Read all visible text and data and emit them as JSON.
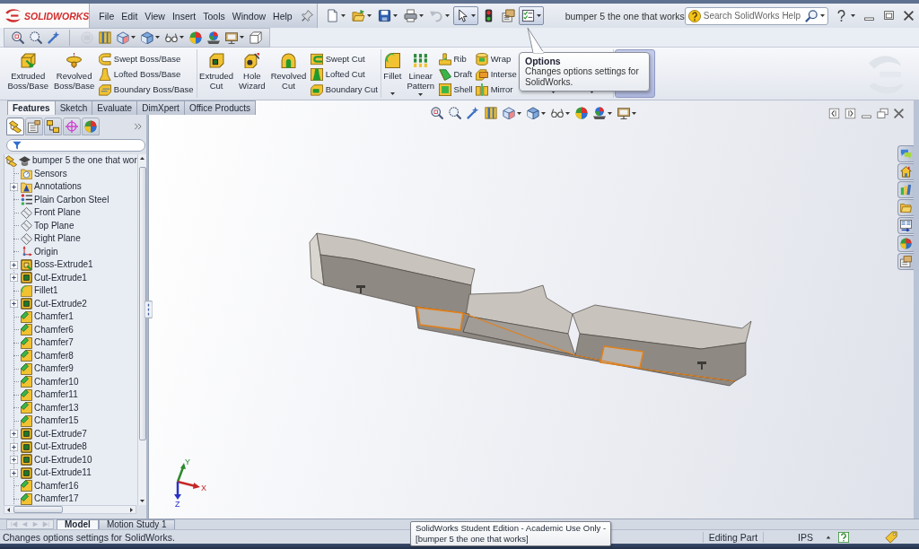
{
  "title_bar": {
    "logo": "SOLIDWORKS",
    "menu": [
      "File",
      "Edit",
      "View",
      "Insert",
      "Tools",
      "Window",
      "Help"
    ],
    "quick_access": [
      {
        "kind": "new",
        "dropdown": true,
        "selected": false,
        "disabled": false
      },
      {
        "kind": "open",
        "dropdown": true,
        "selected": false,
        "disabled": false
      },
      {
        "kind": "save",
        "dropdown": true,
        "selected": false,
        "disabled": false
      },
      {
        "kind": "print",
        "dropdown": true,
        "selected": false,
        "disabled": false
      },
      {
        "kind": "undo",
        "dropdown": true,
        "selected": false,
        "disabled": true
      },
      {
        "kind": "select",
        "dropdown": true,
        "selected": true,
        "disabled": false
      },
      {
        "kind": "rebuild",
        "dropdown": false,
        "selected": false,
        "disabled": false
      },
      {
        "kind": "properties",
        "dropdown": false,
        "selected": false,
        "disabled": false
      },
      {
        "kind": "options",
        "dropdown": true,
        "selected": true,
        "disabled": false
      }
    ],
    "document_title": "bumper 5 the one that works",
    "search": {
      "placeholder": "Search SolidWorks Help"
    }
  },
  "view_toolbar": {
    "groups": [
      {
        "tools": [
          {
            "kind": "zoom-fit",
            "dropdown": false,
            "disabled": false
          },
          {
            "kind": "zoom-area",
            "dropdown": false,
            "disabled": false
          },
          {
            "kind": "previous-view",
            "dropdown": false,
            "disabled": false
          }
        ]
      },
      {
        "tools": [
          {
            "kind": "annotation-view",
            "dropdown": false,
            "disabled": true
          },
          {
            "kind": "section-view",
            "dropdown": false,
            "disabled": false
          },
          {
            "kind": "view-orientation",
            "dropdown": true,
            "disabled": false
          },
          {
            "kind": "display-style",
            "dropdown": true,
            "disabled": false
          },
          {
            "kind": "hide-show",
            "dropdown": true,
            "disabled": false
          },
          {
            "kind": "appearance",
            "dropdown": false,
            "disabled": false
          },
          {
            "kind": "scene",
            "dropdown": false,
            "disabled": false
          },
          {
            "kind": "view-settings",
            "dropdown": true,
            "disabled": false
          },
          {
            "kind": "wireframe",
            "dropdown": false,
            "disabled": false
          }
        ]
      }
    ]
  },
  "ribbon": {
    "groups": [
      {
        "columns": [
          {
            "kind": "extrude-boss",
            "label": "Extruded Boss/Base",
            "dropdown": false
          },
          {
            "kind": "revolve-boss",
            "label": "Revolved Boss/Base",
            "dropdown": false
          },
          {
            "stack": [
              {
                "kind": "swept-boss",
                "label": "Swept Boss/Base"
              },
              {
                "kind": "lofted-boss",
                "label": "Lofted Boss/Base"
              },
              {
                "kind": "boundary-boss",
                "label": "Boundary Boss/Base"
              }
            ]
          }
        ]
      },
      {
        "columns": [
          {
            "kind": "extrude-cut",
            "label": "Extruded Cut",
            "dropdown": false
          },
          {
            "kind": "hole-wizard",
            "label": "Hole Wizard",
            "dropdown": false
          },
          {
            "kind": "revolve-cut",
            "label": "Revolved Cut",
            "dropdown": false
          },
          {
            "stack": [
              {
                "kind": "swept-cut",
                "label": "Swept Cut"
              },
              {
                "kind": "lofted-cut",
                "label": "Lofted Cut"
              },
              {
                "kind": "boundary-cut",
                "label": "Boundary Cut"
              }
            ]
          }
        ]
      },
      {
        "columns": [
          {
            "kind": "fillet",
            "label": "Fillet",
            "dropdown": true
          },
          {
            "kind": "linear-pattern",
            "label": "Linear Pattern",
            "dropdown": true
          },
          {
            "stack": [
              {
                "kind": "rib",
                "label": "Rib"
              },
              {
                "kind": "draft",
                "label": "Draft"
              },
              {
                "kind": "shell",
                "label": "Shell"
              }
            ]
          },
          {
            "stack": [
              {
                "kind": "wrap",
                "label": "Wrap"
              },
              {
                "kind": "intersect",
                "label": "Interse"
              },
              {
                "kind": "mirror",
                "label": "Mirror"
              }
            ]
          },
          {
            "kind": "covered",
            "dropdown": true,
            "highlighted": false
          },
          {
            "kind": "covered",
            "dropdown": true,
            "highlighted": false
          }
        ]
      },
      {
        "columns": [
          {
            "kind": "covered",
            "highlighted": true
          }
        ]
      }
    ]
  },
  "command_tabs": [
    {
      "label": "Features",
      "selected": true
    },
    {
      "label": "Sketch",
      "selected": false
    },
    {
      "label": "Evaluate",
      "selected": false
    },
    {
      "label": "DimXpert",
      "selected": false
    },
    {
      "label": "Office Products",
      "selected": false
    }
  ],
  "options_tooltip": {
    "title": "Options",
    "text": "Changes options settings for SolidWorks."
  },
  "feature_manager": {
    "tabs": [
      {
        "kind": "feature-tree",
        "selected": true
      },
      {
        "kind": "property",
        "selected": false
      },
      {
        "kind": "configuration",
        "selected": false
      },
      {
        "kind": "dimxpert",
        "selected": false
      },
      {
        "kind": "appearance",
        "selected": false
      }
    ],
    "tree": {
      "label": "bumper 5 the one that wor",
      "kind": "part",
      "children": [
        {
          "label": "Sensors",
          "kind": "sensors",
          "expandable": false
        },
        {
          "label": "Annotations",
          "kind": "annotations",
          "expandable": true
        },
        {
          "label": "Plain Carbon Steel",
          "kind": "material",
          "expandable": false
        },
        {
          "label": "Front Plane",
          "kind": "plane",
          "expandable": false
        },
        {
          "label": "Top Plane",
          "kind": "plane",
          "expandable": false
        },
        {
          "label": "Right Plane",
          "kind": "plane",
          "expandable": false
        },
        {
          "label": "Origin",
          "kind": "origin",
          "expandable": false
        },
        {
          "label": "Boss-Extrude1",
          "kind": "boss",
          "expandable": true
        },
        {
          "label": "Cut-Extrude1",
          "kind": "cut",
          "expandable": true
        },
        {
          "label": "Fillet1",
          "kind": "fillet",
          "expandable": false
        },
        {
          "label": "Cut-Extrude2",
          "kind": "cut",
          "expandable": true
        },
        {
          "label": "Chamfer1",
          "kind": "chamfer",
          "expandable": false
        },
        {
          "label": "Chamfer6",
          "kind": "chamfer",
          "expandable": false
        },
        {
          "label": "Chamfer7",
          "kind": "chamfer",
          "expandable": false
        },
        {
          "label": "Chamfer8",
          "kind": "chamfer",
          "expandable": false
        },
        {
          "label": "Chamfer9",
          "kind": "chamfer",
          "expandable": false
        },
        {
          "label": "Chamfer10",
          "kind": "chamfer",
          "expandable": false
        },
        {
          "label": "Chamfer11",
          "kind": "chamfer",
          "expandable": false
        },
        {
          "label": "Chamfer13",
          "kind": "chamfer",
          "expandable": false
        },
        {
          "label": "Chamfer15",
          "kind": "chamfer",
          "expandable": false
        },
        {
          "label": "Cut-Extrude7",
          "kind": "cut",
          "expandable": true
        },
        {
          "label": "Cut-Extrude8",
          "kind": "cut",
          "expandable": true
        },
        {
          "label": "Cut-Extrude10",
          "kind": "cut",
          "expandable": true
        },
        {
          "label": "Cut-Extrude11",
          "kind": "cut",
          "expandable": true
        },
        {
          "label": "Chamfer16",
          "kind": "chamfer",
          "expandable": false
        },
        {
          "label": "Chamfer17",
          "kind": "chamfer",
          "expandable": false
        }
      ]
    }
  },
  "viewport": {
    "heads_up_toolbar": [
      {
        "kind": "zoom-fit",
        "dropdown": false
      },
      {
        "kind": "zoom-area",
        "dropdown": false
      },
      {
        "kind": "previous-view",
        "dropdown": false
      },
      {
        "kind": "section-view",
        "dropdown": false
      },
      {
        "kind": "view-orientation",
        "dropdown": true
      },
      {
        "kind": "display-style",
        "dropdown": true
      },
      {
        "kind": "hide-show",
        "dropdown": true
      },
      {
        "kind": "appearance",
        "dropdown": false
      },
      {
        "kind": "scene",
        "dropdown": true
      },
      {
        "kind": "view-settings",
        "dropdown": true
      }
    ],
    "triad_labels": [
      "Y",
      "X",
      "Z"
    ]
  },
  "bottom_tabs": [
    {
      "label": "Model",
      "selected": true
    },
    {
      "label": "Motion Study 1",
      "selected": false
    }
  ],
  "status_bar": {
    "message": "Changes options settings for SolidWorks.",
    "mode": "Editing Part",
    "units": "IPS"
  },
  "status_tooltip": {
    "lines": [
      "SolidWorks Student Edition - Academic Use Only -",
      "[bumper 5 the one that works]"
    ]
  }
}
